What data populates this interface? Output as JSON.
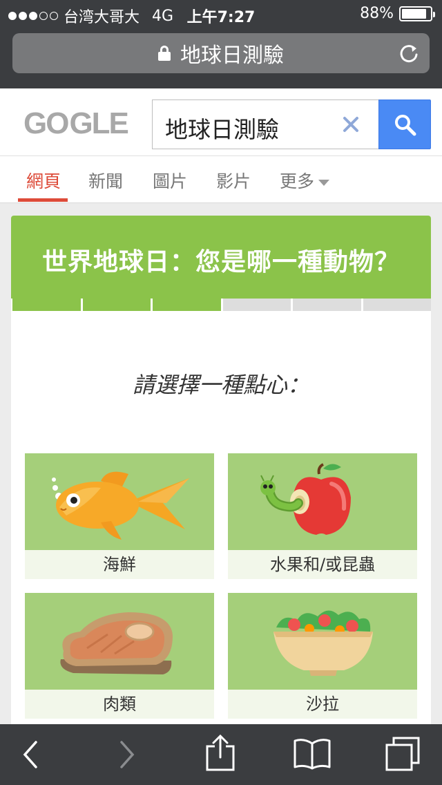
{
  "status_bar": {
    "carrier": "台湾大哥大",
    "network": "4G",
    "time": "上午7:27",
    "battery": "88%",
    "battery_level": 0.88,
    "signal_strength": 3,
    "signal_max": 5
  },
  "browser": {
    "url_text": "地球日測驗",
    "icons": [
      "lock-icon",
      "reload-icon"
    ]
  },
  "google": {
    "logo_text_left": "GO",
    "logo_text_right": "GLE",
    "search_query": "地球日測驗",
    "accent": "#4a8af4"
  },
  "tabs": [
    {
      "label": "網頁",
      "active": true
    },
    {
      "label": "新聞",
      "active": false
    },
    {
      "label": "圖片",
      "active": false
    },
    {
      "label": "影片",
      "active": false
    },
    {
      "label": "更多",
      "active": false
    }
  ],
  "quiz": {
    "title": "世界地球日：您是哪一種動物？",
    "progress": {
      "completed": 3,
      "total": 6
    },
    "question": "請選擇一種點心：",
    "options": [
      {
        "label": "海鮮",
        "icon": "fish-icon"
      },
      {
        "label": "水果和/或昆蟲",
        "icon": "apple-worm-icon"
      },
      {
        "label": "肉類",
        "icon": "steak-icon"
      },
      {
        "label": "沙拉",
        "icon": "salad-bowl-icon"
      }
    ],
    "colors": {
      "header": "#8bc34a",
      "option_bg": "#a5cf7a"
    }
  },
  "toolbar": {
    "icons": [
      "back-icon",
      "forward-icon",
      "share-icon",
      "bookmarks-icon",
      "tabs-icon"
    ]
  }
}
